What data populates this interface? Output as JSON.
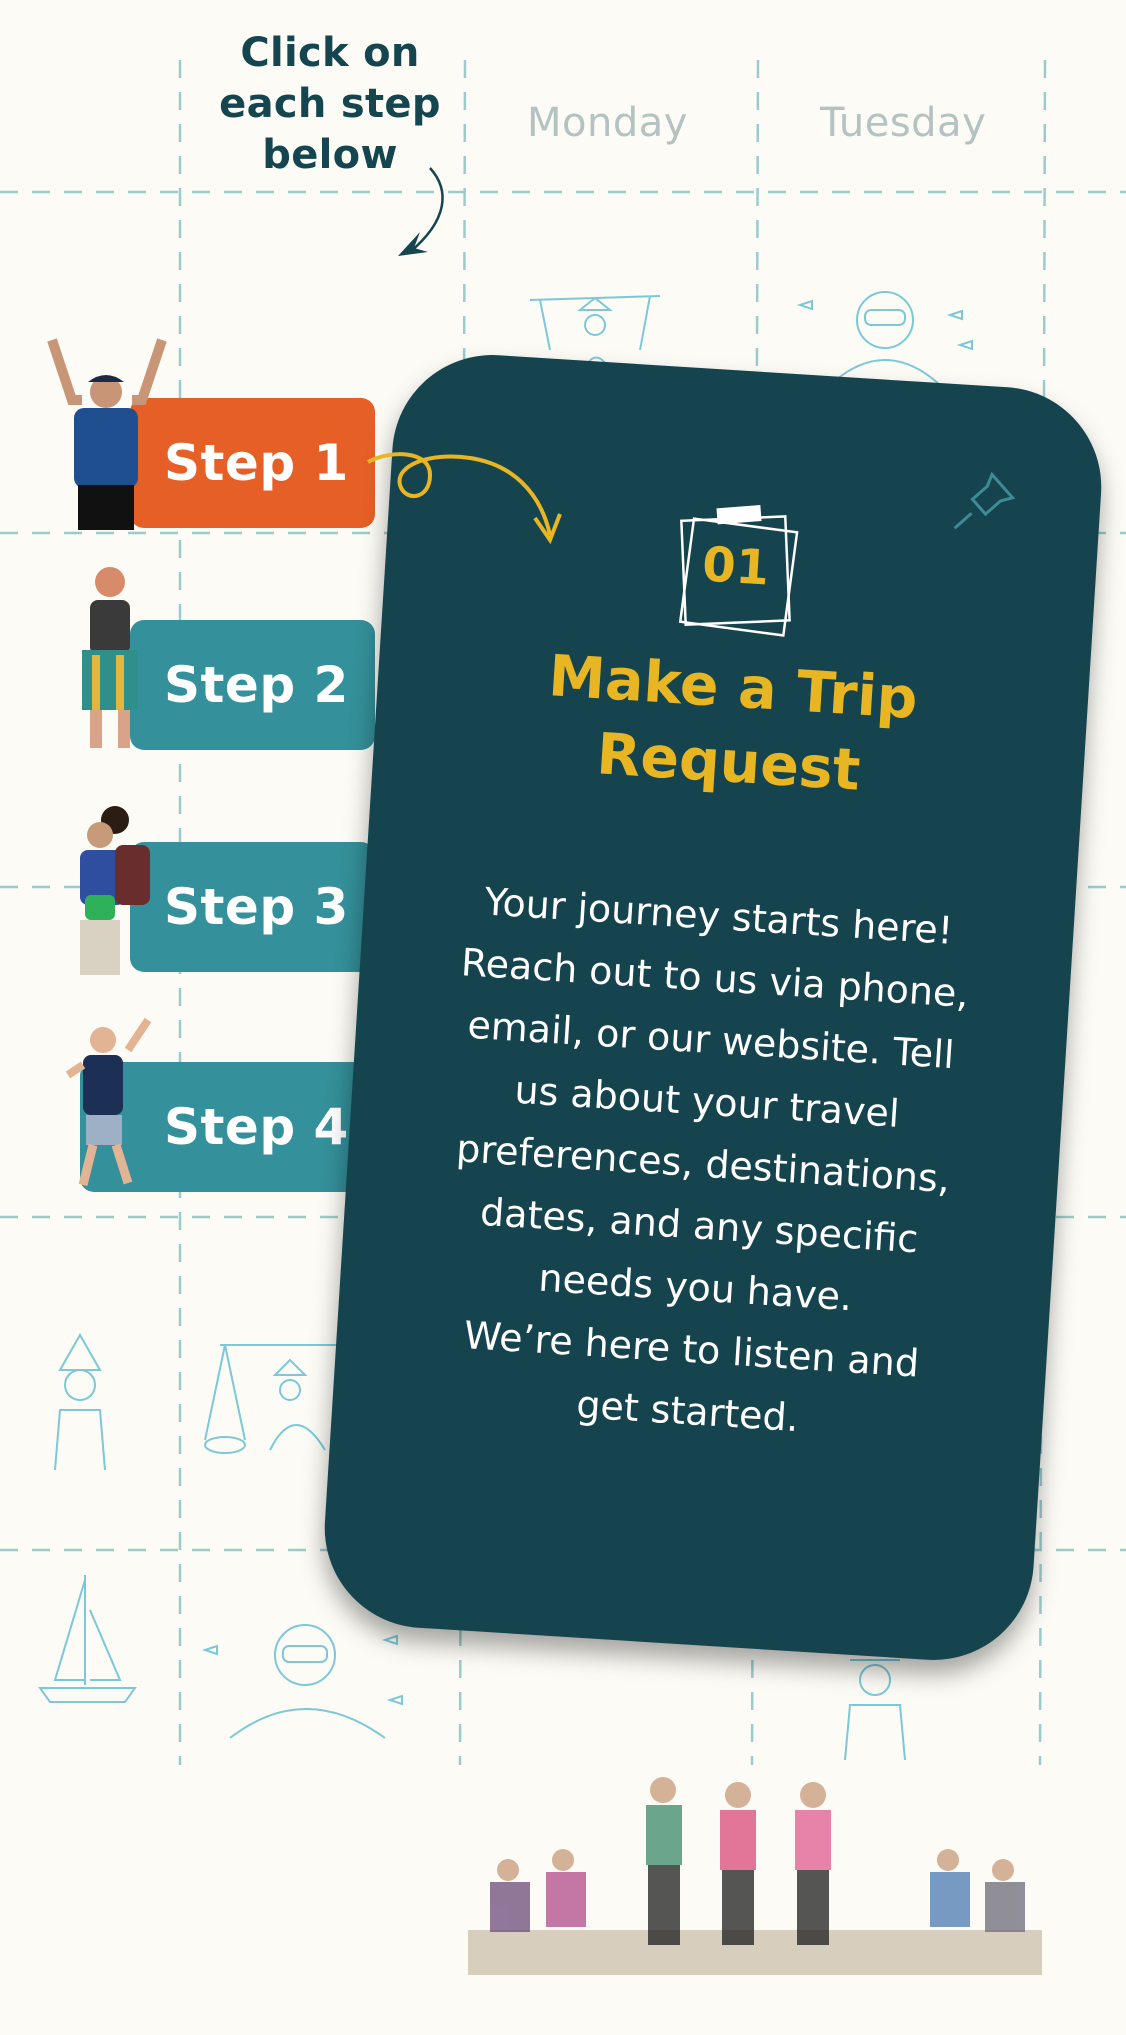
{
  "hint": {
    "lines": [
      "Click on",
      "each step",
      "below"
    ]
  },
  "days": [
    "Monday",
    "Tuesday"
  ],
  "steps": [
    {
      "label": "Step 1",
      "active": true
    },
    {
      "label": "Step 2",
      "active": false
    },
    {
      "label": "Step 3",
      "active": false
    },
    {
      "label": "Step 4",
      "active": false
    }
  ],
  "card": {
    "number": "01",
    "title_lines": [
      "Make a Trip",
      "Request"
    ],
    "body_lines": [
      "Your journey starts here!",
      "Reach out to us via phone,",
      "email, or our website. Tell",
      "us about your travel",
      "preferences, destinations,",
      "dates, and any specific",
      "needs you have.",
      "We’re here to listen and",
      "get started."
    ]
  },
  "colors": {
    "active_step": "#e65f26",
    "inactive_step": "#34909a",
    "card_bg": "#15444f",
    "accent": "#e8b622",
    "sketch": "#7cc8d8"
  },
  "icons": {
    "hint_arrow": "curved-arrow-icon",
    "card_arrow": "loop-arrow-icon",
    "pin": "push-pin-icon",
    "note": "sticky-note-icon"
  }
}
